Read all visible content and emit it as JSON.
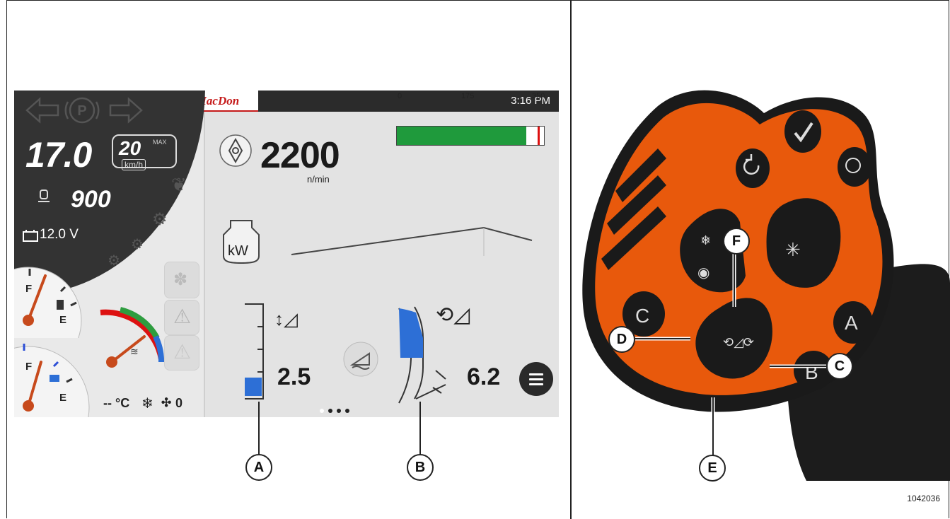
{
  "screen": {
    "brand": "MacDon",
    "clock": "3:16 PM",
    "speed": "17.0",
    "max_speed": "20",
    "max_label": "MAX",
    "speed_unit": "km/h",
    "engine_rpm": "900",
    "voltage": "12.0 V",
    "fuel_full": "F",
    "fuel_empty": "E",
    "def_full": "F",
    "def_empty": "E",
    "climate_text": "-- °C",
    "fan_speed": "0",
    "header_speed": "2200",
    "header_speed_unit": "n/min",
    "scale_min": "0",
    "scale_mid": "175",
    "scale_max": "350",
    "scale_fill_fraction": 0.88,
    "power_icon_label": "kW",
    "header_height_value": "2.5",
    "reel_tilt_value": "6.2",
    "page_count": 4,
    "active_page": 1
  },
  "callouts": [
    "A",
    "B",
    "C",
    "D",
    "E",
    "F"
  ],
  "joystick": {
    "buttons": [
      "C",
      "A",
      "B"
    ]
  },
  "figure_number": "1042036",
  "colors": {
    "brand_red": "#c51a1a",
    "bar_green": "#1f9a3c",
    "indicator_blue": "#2d6fd6",
    "handle_orange": "#e8590c",
    "handle_black": "#1a1a1a",
    "dial_dark": "#333333"
  }
}
